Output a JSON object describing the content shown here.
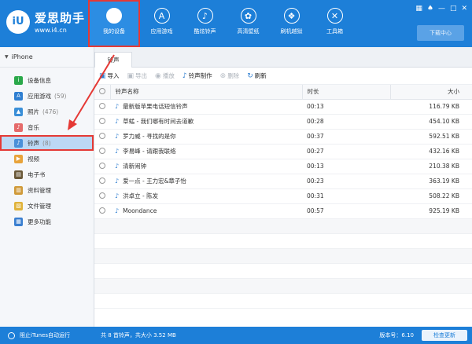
{
  "app": {
    "title": "爱思助手",
    "url": "www.i4.cn",
    "logo_letter": "iU"
  },
  "nav": [
    {
      "label": "我的设备",
      "icon": "apple-icon",
      "glyph": "",
      "active": true
    },
    {
      "label": "应用游戏",
      "icon": "app-store-icon",
      "glyph": "A",
      "active": false
    },
    {
      "label": "酷炫铃声",
      "icon": "bell-icon",
      "glyph": "♪",
      "active": false
    },
    {
      "label": "高清壁纸",
      "icon": "flower-icon",
      "glyph": "✿",
      "active": false
    },
    {
      "label": "刷机越狱",
      "icon": "box-icon",
      "glyph": "❖",
      "active": false
    },
    {
      "label": "工具箱",
      "icon": "tools-icon",
      "glyph": "✕",
      "active": false
    }
  ],
  "window_controls": [
    "▦",
    "♠",
    "—",
    "□",
    "✕"
  ],
  "download_center": "下载中心",
  "device": "iPhone",
  "sidebar": [
    {
      "label": "设备信息",
      "count": "",
      "icon": "info-icon",
      "color": "#2aa84a",
      "glyph": "i"
    },
    {
      "label": "应用游戏",
      "count": "(59)",
      "icon": "apps-icon",
      "color": "#2f7fd1",
      "glyph": "A"
    },
    {
      "label": "照片",
      "count": "(476)",
      "icon": "photo-icon",
      "color": "#3a8fd8",
      "glyph": "▲"
    },
    {
      "label": "音乐",
      "count": "",
      "icon": "music-icon",
      "color": "#e56b6b",
      "glyph": "♪"
    },
    {
      "label": "铃声",
      "count": "(8)",
      "icon": "bell-icon",
      "color": "#4a90d9",
      "glyph": "♪",
      "active": true
    },
    {
      "label": "视频",
      "count": "",
      "icon": "video-icon",
      "color": "#e8a33a",
      "glyph": "▶"
    },
    {
      "label": "电子书",
      "count": "",
      "icon": "book-icon",
      "color": "#6b5a3a",
      "glyph": "▤"
    },
    {
      "label": "资料管理",
      "count": "",
      "icon": "contacts-icon",
      "color": "#d09a3a",
      "glyph": "▥"
    },
    {
      "label": "文件管理",
      "count": "",
      "icon": "folder-icon",
      "color": "#e0b33a",
      "glyph": "▧"
    },
    {
      "label": "更多功能",
      "count": "",
      "icon": "grid-icon",
      "color": "#3a7fd0",
      "glyph": "▦"
    }
  ],
  "tab": "铃声",
  "toolbar": [
    {
      "label": "导入",
      "icon": "import-icon",
      "glyph": "▣",
      "enabled": true
    },
    {
      "label": "导出",
      "icon": "export-icon",
      "glyph": "▣",
      "enabled": false
    },
    {
      "label": "播放",
      "icon": "play-icon",
      "glyph": "◉",
      "enabled": false
    },
    {
      "label": "铃声制作",
      "icon": "bell-make-icon",
      "glyph": "♪",
      "enabled": true
    },
    {
      "label": "删除",
      "icon": "delete-icon",
      "glyph": "⊗",
      "enabled": false
    },
    {
      "label": "刷新",
      "icon": "refresh-icon",
      "glyph": "↻",
      "enabled": true
    }
  ],
  "columns": {
    "name": "铃声名称",
    "duration": "时长",
    "size": "大小"
  },
  "rows": [
    {
      "name": "最新版苹果电话短信铃声",
      "duration": "00:13",
      "size": "116.79 KB"
    },
    {
      "name": "草蜢 - 我们哪有时间去道歉",
      "duration": "00:28",
      "size": "454.10 KB"
    },
    {
      "name": "罗力威 - 寻找的是你",
      "duration": "00:37",
      "size": "592.51 KB"
    },
    {
      "name": "李易峰 - 请跟我联络",
      "duration": "00:27",
      "size": "432.16 KB"
    },
    {
      "name": "清新闹钟",
      "duration": "00:13",
      "size": "210.38 KB"
    },
    {
      "name": "爱一点 - 王力宏&章子怡",
      "duration": "00:23",
      "size": "363.19 KB"
    },
    {
      "name": "洪卓立 - 陈发",
      "duration": "00:31",
      "size": "508.22 KB"
    },
    {
      "name": "Moondance",
      "duration": "00:57",
      "size": "925.19 KB"
    }
  ],
  "status": {
    "itunes": "阻止iTunes自动运行",
    "summary": "共 8 首铃声，共大小 3.52 MB",
    "version": "版本号：6.10",
    "update": "检查更新"
  },
  "colors": {
    "brand": "#1d7fd8",
    "highlight": "#e53935",
    "selected": "#bcd8f4"
  }
}
